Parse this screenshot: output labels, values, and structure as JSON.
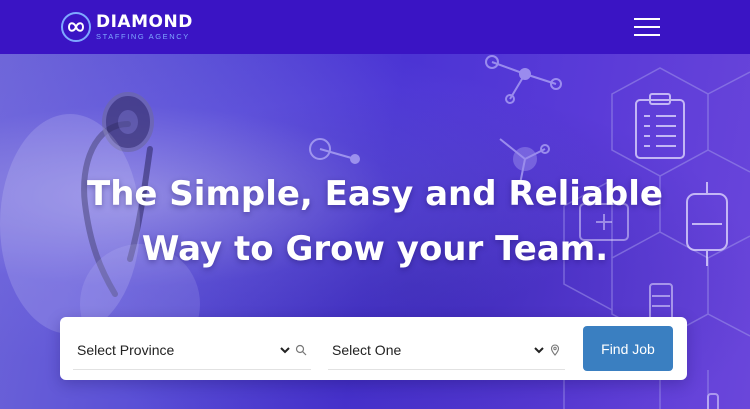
{
  "brand": {
    "name": "DIAMOND",
    "tagline": "STAFFING AGENCY",
    "logo_icon": "diamond-infinity-logo"
  },
  "nav": {
    "menu_icon": "hamburger-menu-icon"
  },
  "hero": {
    "headline_line1": "The Simple, Easy and Reliable",
    "headline_line2": "Way to Grow your Team."
  },
  "search": {
    "province_select": {
      "selected": "Select Province",
      "icon": "search-icon"
    },
    "category_select": {
      "selected": "Select One",
      "icon": "map-pin-icon"
    },
    "submit_label": "Find Job"
  },
  "colors": {
    "topbar": "#3a14c4",
    "hero_accent": "#4b34d4",
    "button": "#3a7fc1",
    "logo_sub": "#7fa8ff"
  }
}
